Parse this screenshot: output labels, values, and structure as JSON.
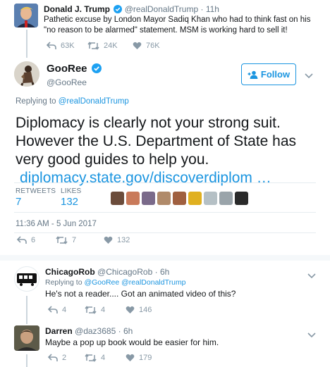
{
  "tweet1": {
    "name": "Donald J. Trump",
    "handle": "@realDonaldTrump",
    "sep": "·",
    "time": "11h",
    "text": "Pathetic excuse by London Mayor Sadiq Khan who had to think fast on his \"no reason to be alarmed\" statement. MSM is working hard to sell it!",
    "replies": "63K",
    "retweets": "24K",
    "likes": "76K"
  },
  "main": {
    "name": "GooRee",
    "handle": "@GooRee",
    "follow_label": "Follow",
    "replying_prefix": "Replying to ",
    "replying_to": "@realDonaldTrump",
    "text": "Diplomacy is clearly not your strong suit. However the U.S. Department of State has very good guides to help you. ",
    "link": "diplomacy.state.gov/discoverdiplom …",
    "retweets_label": "RETWEETS",
    "retweets_value": "7",
    "likes_label": "LIKES",
    "likes_value": "132",
    "timestamp": "11:36 AM - 5 Jun 2017",
    "replies": "6",
    "rt_count": "7",
    "like_count": "132",
    "liker_colors": [
      "#6b4c3b",
      "#c97a5a",
      "#7a6a8a",
      "#b08a6a",
      "#a06040",
      "#e0b020",
      "#b5c0c5",
      "#9aa4aa",
      "#2a2a2a"
    ]
  },
  "reply1": {
    "name": "ChicagoRob",
    "handle": "@ChicagoRob",
    "sep": "·",
    "time": "6h",
    "replying_prefix": "Replying to ",
    "replying_to": "@GooRee @realDonaldTrump",
    "text": "He's not a reader.... Got an animated video of this?",
    "replies": "4",
    "retweets": "4",
    "likes": "146"
  },
  "reply2": {
    "name": "Darren",
    "handle": "@daz3685",
    "sep": "·",
    "time": "6h",
    "text": "Maybe a pop up book would be easier for him.",
    "replies": "2",
    "retweets": "4",
    "likes": "179"
  },
  "colors": {
    "accent": "#1b95e0",
    "verified": "#1da1f2",
    "muted": "#657786",
    "icon": "#8899a6"
  }
}
